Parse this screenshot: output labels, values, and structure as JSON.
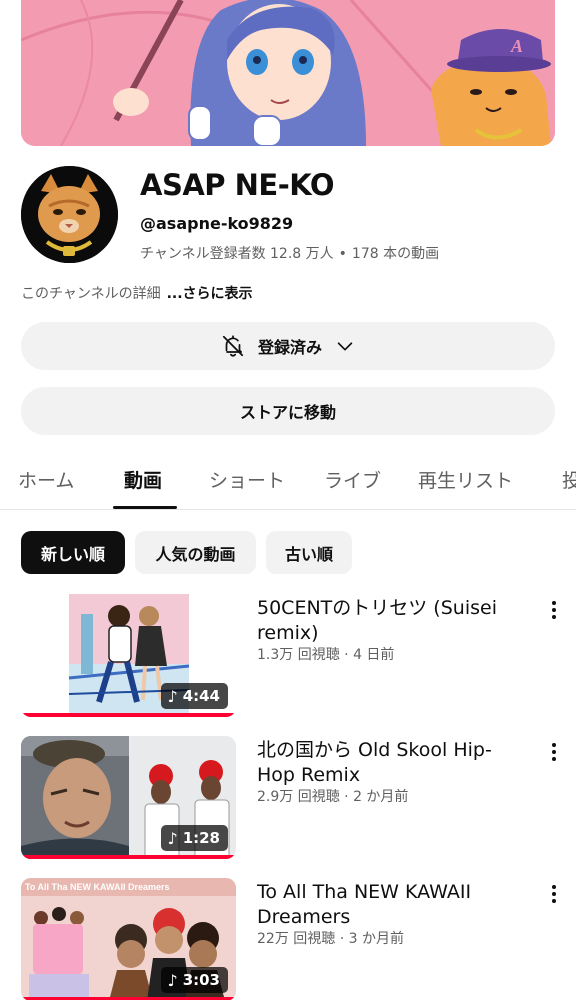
{
  "channel": {
    "name": "ASAP NE-KO",
    "handle": "@asapne-ko9829",
    "subscribers": "チャンネル登録者数 12.8 万人",
    "separator": "•",
    "video_count": "178 本の動画",
    "description": "このチャンネルの詳細",
    "more_label": "...さらに表示"
  },
  "buttons": {
    "subscribe_label": "登録済み",
    "store_label": "ストアに移動"
  },
  "tabs": [
    {
      "label": "ホーム",
      "active": false
    },
    {
      "label": "動画",
      "active": true
    },
    {
      "label": "ショート",
      "active": false
    },
    {
      "label": "ライブ",
      "active": false
    },
    {
      "label": "再生リスト",
      "active": false
    },
    {
      "label": "投",
      "active": false
    }
  ],
  "chips": [
    {
      "label": "新しい順",
      "active": true
    },
    {
      "label": "人気の動画",
      "active": false
    },
    {
      "label": "古い順",
      "active": false
    }
  ],
  "videos": [
    {
      "title": "50CENTのトリセツ (Suisei remix)",
      "meta": "1.3万 回視聴 · 4 日前",
      "duration": "4:44",
      "watched_fraction": 1.0
    },
    {
      "title": "北の国から Old Skool Hip-Hop Remix",
      "meta": "2.9万 回視聴 · 2 か月前",
      "duration": "1:28",
      "watched_fraction": 1.0
    },
    {
      "title": "To All Tha NEW KAWAII Dreamers",
      "meta": "22万 回視聴 · 3 か月前",
      "duration": "3:03",
      "watched_fraction": 1.0,
      "thumb_caption": "To All Tha NEW KAWAII Dreamers"
    }
  ],
  "icons": {
    "music": "♪",
    "bell_off": "bell-off-icon",
    "chevron": "chevron-down-icon"
  },
  "colors": {
    "accent_red": "#ff0033",
    "banner_pink": "#f39bb1",
    "chip_active": "#0f0f0f",
    "chip_bg": "#f2f2f2"
  }
}
